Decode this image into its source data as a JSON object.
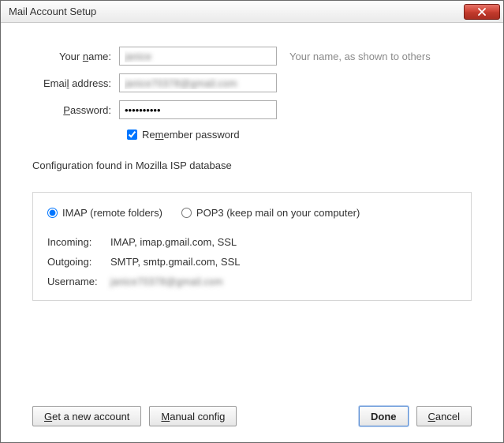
{
  "window": {
    "title": "Mail Account Setup"
  },
  "form": {
    "name_label_pre": "Your ",
    "name_label_u": "n",
    "name_label_post": "ame:",
    "name_value": "janice",
    "name_hint": "Your name, as shown to others",
    "email_label_pre": "Emai",
    "email_label_u": "l",
    "email_label_post": " address:",
    "email_value": "janice70378@gmail.com",
    "password_label_u": "P",
    "password_label_post": "assword:",
    "password_value": "••••••••••",
    "remember_label_pre": "Re",
    "remember_label_u": "m",
    "remember_label_post": "ember password",
    "remember_checked": true
  },
  "status": "Configuration found in Mozilla ISP database",
  "protocol": {
    "imap_label": "IMAP (remote folders)",
    "pop3_label": "POP3 (keep mail on your computer)",
    "selected": "imap"
  },
  "config": {
    "incoming_label": "Incoming:",
    "incoming_value": "IMAP, imap.gmail.com, SSL",
    "outgoing_label": "Outgoing:",
    "outgoing_value": "SMTP, smtp.gmail.com, SSL",
    "username_label": "Username:",
    "username_value": "janice70378@gmail.com"
  },
  "buttons": {
    "get_account_u": "G",
    "get_account_post": "et a new account",
    "manual_u": "M",
    "manual_post": "anual config",
    "done": "Done",
    "cancel_pre": "",
    "cancel_u": "C",
    "cancel_post": "ancel"
  }
}
